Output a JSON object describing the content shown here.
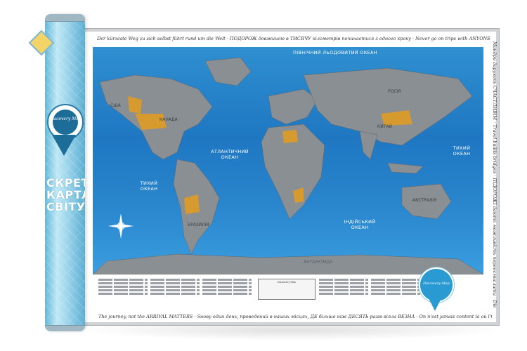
{
  "poster": {
    "top_quote": "Der kürzeste Weg zu sich selbst führt rund um die Welt · ПОДОРОЖ довжиною в ТИСЯЧУ кілометрів починається з одного кроку · Never go on trips with ANYONE you do not love",
    "bottom_quote": "The journey, not the ARRIVAL MATTERS · Ѕнову один день, проведений в наших місцях, ДЕ більше ніж ДЕСЯТЬ разів віяла ВЕЗНА · On n'est jamais content là où l'ON EST",
    "right_quote": "Мандри дарують СЧАСТЛИВІМ · Travel builds bridges · ПІДОРОЖІ дають можливість переосмислити · Die Welt ist ein Buch"
  },
  "map": {
    "oceans": {
      "arctic": "ПІВНІЧНИЙ ЛЬОДОВИТИЙ ОКЕАН",
      "atlantic": "АТЛАНТИЧНИЙ\nОКЕАН",
      "pacific_west": "ТИХИЙ\nОКЕАН",
      "pacific_east": "ТИХИЙ\nОКЕАН",
      "indian": "ІНДІЙСЬКИЙ\nОКЕАН"
    },
    "antarctica": "АНТАРКТИДА",
    "continents": {
      "russia": "РОСІЯ",
      "usa": "США",
      "canada": "КАНАДА",
      "brazil": "БРАЗИЛІЯ",
      "australia": "АВСТРАЛІЯ",
      "china": "КИТАЙ"
    }
  },
  "legend": {
    "center_title": "Discovery Map"
  },
  "badge": {
    "title": "Discovery Map"
  },
  "tube": {
    "emblem": "Discovery Map",
    "title": "СКРЕТЧ КАРТА СВІТУ"
  },
  "colors": {
    "ocean": "#1f77c2",
    "land": "#8a8f94",
    "scratched": "#d79a2e",
    "tube": "#8fd0ea"
  }
}
